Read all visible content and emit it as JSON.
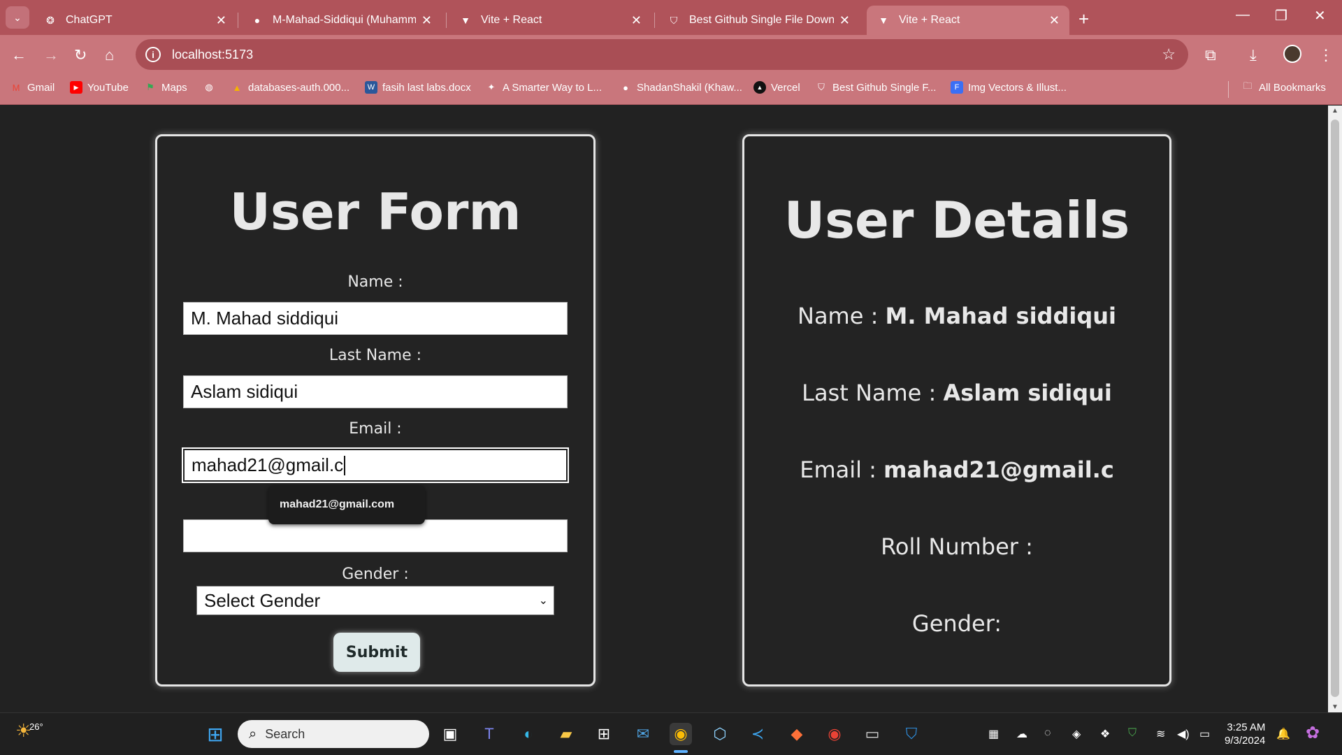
{
  "browser": {
    "tabs": [
      {
        "title": "ChatGPT",
        "icon": "chatgpt-icon"
      },
      {
        "title": "M-Mahad-Siddiqui (Muhammad",
        "icon": "github-icon"
      },
      {
        "title": "Vite + React",
        "icon": "vite-icon"
      },
      {
        "title": "Best Github Single File Downlo",
        "icon": "shield-icon"
      },
      {
        "title": "Vite + React",
        "icon": "vite-icon",
        "active": true
      }
    ],
    "url": "localhost:5173",
    "bookmarks": [
      {
        "label": "Gmail"
      },
      {
        "label": "YouTube"
      },
      {
        "label": "Maps"
      },
      {
        "label": ""
      },
      {
        "label": "databases-auth.000..."
      },
      {
        "label": "fasih last labs.docx"
      },
      {
        "label": "A Smarter Way to L..."
      },
      {
        "label": "ShadanShakil (Khaw..."
      },
      {
        "label": "Vercel"
      },
      {
        "label": "Best Github Single F..."
      },
      {
        "label": "Img Vectors & Illust..."
      }
    ],
    "all_bookmarks": "All Bookmarks",
    "accent_color": "#c9767c"
  },
  "form": {
    "title": "User Form",
    "name_label": "Name :",
    "name_value": "M. Mahad siddiqui",
    "last_name_label": "Last Name :",
    "last_name_value": "Aslam sidiqui",
    "email_label": "Email :",
    "email_value": "mahad21@gmail.c",
    "roll_value": "",
    "gender_label": "Gender :",
    "gender_selected": "Select Gender",
    "submit_label": "Submit",
    "autofill_suggestion": "mahad21@gmail.com"
  },
  "details": {
    "title": "User Details",
    "name_label": "Name :",
    "name_value": "M. Mahad siddiqui",
    "last_name_label": "Last Name :",
    "last_name_value": "Aslam sidiqui",
    "email_label": "Email :",
    "email_value": "mahad21@gmail.c",
    "roll_label": "Roll Number :",
    "gender_label": "Gender:"
  },
  "taskbar": {
    "weather_temp": "26°",
    "search_placeholder": "Search",
    "time": "3:25 AM",
    "date": "9/3/2024"
  }
}
